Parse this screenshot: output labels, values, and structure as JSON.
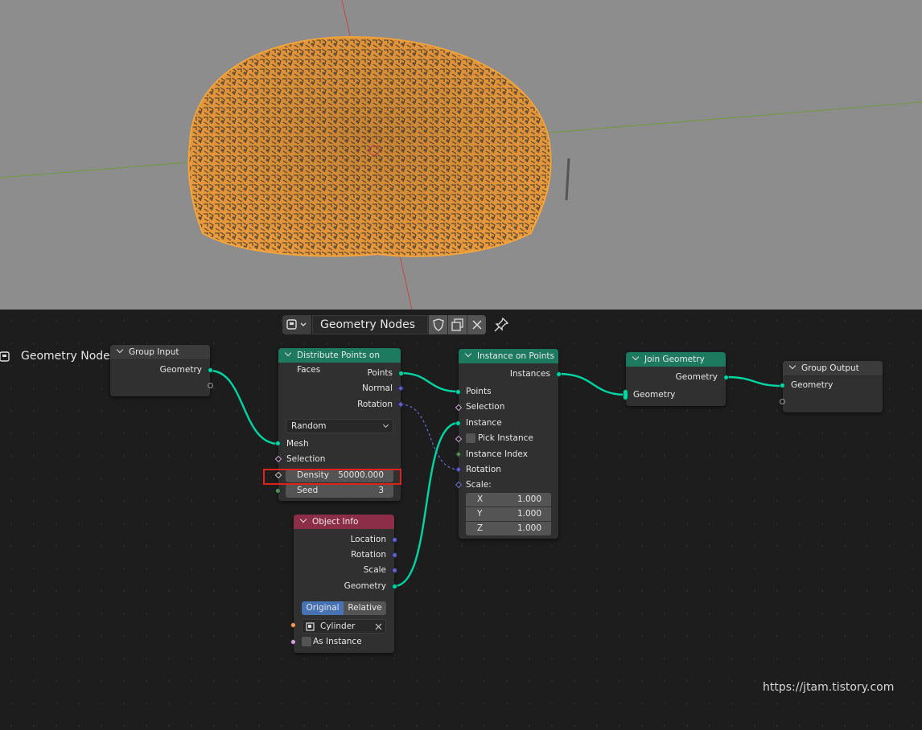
{
  "editor_header": {
    "tree_name": "Geometry Nodes",
    "type_icon": "node-editor-type-icon",
    "buttons": [
      "fake-user-shield-icon",
      "duplicate-icon",
      "close-icon",
      "pin-icon"
    ]
  },
  "tree_label": "Geometry Nodes",
  "nodes": {
    "group_input": {
      "title": "Group Input",
      "outputs": [
        "Geometry"
      ]
    },
    "distribute": {
      "title": "Distribute Points on Faces",
      "outputs": [
        "Points",
        "Normal",
        "Rotation"
      ],
      "mode": "Random",
      "inputs": [
        "Mesh",
        "Selection"
      ],
      "density_label": "Density",
      "density_value": "50000.000",
      "seed_label": "Seed",
      "seed_value": "3"
    },
    "instance": {
      "title": "Instance on Points",
      "outputs": [
        "Instances"
      ],
      "inputs": [
        "Points",
        "Selection",
        "Instance",
        "Pick Instance",
        "Instance Index",
        "Rotation",
        "Scale:"
      ],
      "scale_x_label": "X",
      "scale_x": "1.000",
      "scale_y_label": "Y",
      "scale_y": "1.000",
      "scale_z_label": "Z",
      "scale_z": "1.000"
    },
    "join": {
      "title": "Join Geometry",
      "outputs": [
        "Geometry"
      ],
      "inputs": [
        "Geometry"
      ]
    },
    "group_output": {
      "title": "Group Output",
      "inputs": [
        "Geometry"
      ]
    },
    "object_info": {
      "title": "Object Info",
      "outputs": [
        "Location",
        "Rotation",
        "Scale",
        "Geometry"
      ],
      "mode_options": [
        "Original",
        "Relative"
      ],
      "mode_selected": "Original",
      "object": "Cylinder",
      "as_instance": "As Instance"
    }
  },
  "watermark": "https://jtam.tistory.com",
  "colors": {
    "geometry_header": "#1d7a5e",
    "object_header": "#8c2e48",
    "geometry_socket": "#00d6a3",
    "vector_socket": "#6363c7",
    "selection_highlight": "#e0221d",
    "viewport_bg": "#8d8d8d",
    "scattered_instances": "#f5a53c"
  }
}
